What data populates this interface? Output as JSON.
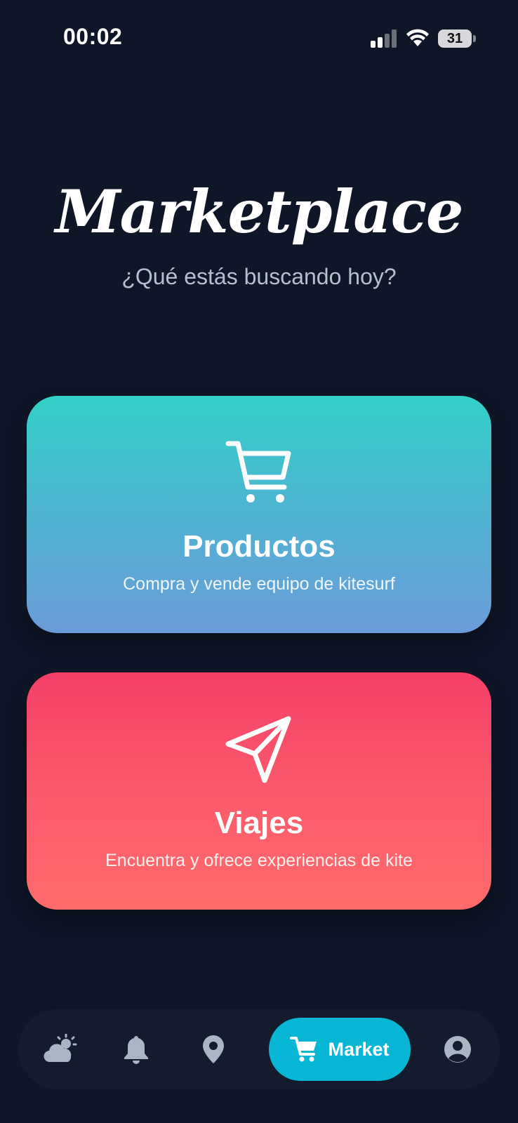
{
  "status_bar": {
    "time": "00:02",
    "battery_level": "31",
    "icons": [
      "signal-icon",
      "wifi-icon",
      "battery-icon"
    ]
  },
  "header": {
    "title": "Marketplace",
    "subtitle": "¿Qué estás buscando hoy?"
  },
  "cards": [
    {
      "title": "Productos",
      "description": "Compra y vende equipo de kitesurf",
      "icon": "cart-icon",
      "gradient": [
        "#33d0c7",
        "#6b9bd9"
      ]
    },
    {
      "title": "Viajes",
      "description": "Encuentra y ofrece experiencias de kite",
      "icon": "paper-plane-icon",
      "gradient": [
        "#f43f68",
        "#ff6b6b"
      ]
    }
  ],
  "bottom_nav": {
    "items": [
      {
        "icon": "weather-icon",
        "active": false
      },
      {
        "icon": "bell-icon",
        "active": false
      },
      {
        "icon": "location-pin-icon",
        "active": false
      },
      {
        "icon": "cart-icon",
        "label": "Market",
        "active": true
      },
      {
        "icon": "user-icon",
        "active": false
      }
    ],
    "active_color": "#06b6d4",
    "inactive_color": "#aab4c3"
  },
  "colors": {
    "background": "#0f1627",
    "subtitle": "#b6bfcd"
  }
}
